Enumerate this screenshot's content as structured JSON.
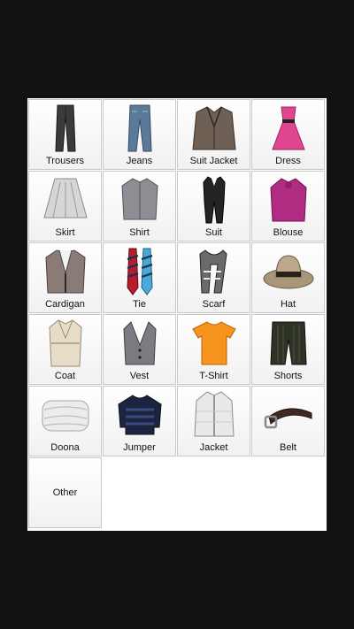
{
  "colors": {
    "background": "#121212",
    "panel": "#ffffff",
    "tile_border": "#c9c9c9"
  },
  "items": [
    {
      "label": "Trousers",
      "icon": "trousers-icon"
    },
    {
      "label": "Jeans",
      "icon": "jeans-icon"
    },
    {
      "label": "Suit Jacket",
      "icon": "suit-jacket-icon"
    },
    {
      "label": "Dress",
      "icon": "dress-icon"
    },
    {
      "label": "Skirt",
      "icon": "skirt-icon"
    },
    {
      "label": "Shirt",
      "icon": "shirt-icon"
    },
    {
      "label": "Suit",
      "icon": "suit-icon"
    },
    {
      "label": "Blouse",
      "icon": "blouse-icon"
    },
    {
      "label": "Cardigan",
      "icon": "cardigan-icon"
    },
    {
      "label": "Tie",
      "icon": "tie-icon"
    },
    {
      "label": "Scarf",
      "icon": "scarf-icon"
    },
    {
      "label": "Hat",
      "icon": "hat-icon"
    },
    {
      "label": "Coat",
      "icon": "coat-icon"
    },
    {
      "label": "Vest",
      "icon": "vest-icon"
    },
    {
      "label": "T-Shirt",
      "icon": "t-shirt-icon"
    },
    {
      "label": "Shorts",
      "icon": "shorts-icon"
    },
    {
      "label": "Doona",
      "icon": "doona-icon"
    },
    {
      "label": "Jumper",
      "icon": "jumper-icon"
    },
    {
      "label": "Jacket",
      "icon": "jacket-icon"
    },
    {
      "label": "Belt",
      "icon": "belt-icon"
    },
    {
      "label": "Other",
      "icon": ""
    }
  ]
}
